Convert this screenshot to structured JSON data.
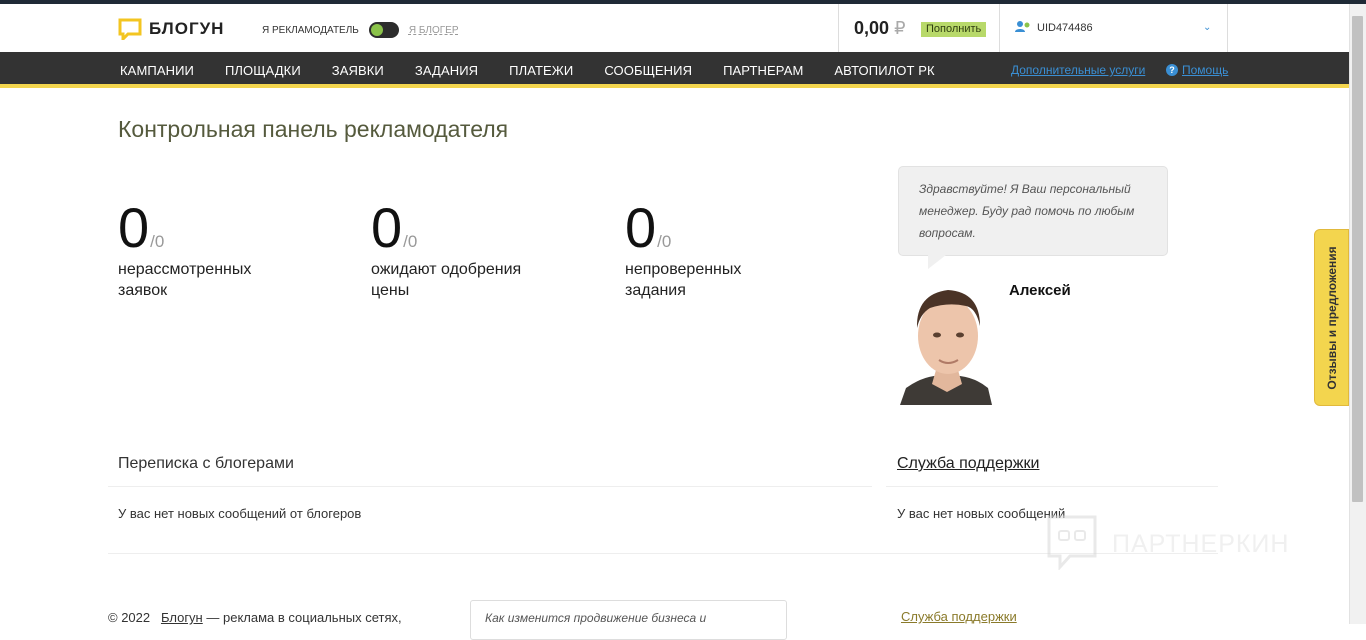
{
  "header": {
    "logo_text": "БЛОГУН",
    "role_active": "Я РЕКЛАМОДАТЕЛЬ",
    "role_inactive": "Я БЛОГЕР",
    "balance": "0,00",
    "currency": "₽",
    "topup_label": "Пополнить",
    "user_id": "UID474486"
  },
  "nav": {
    "items": [
      "КАМПАНИИ",
      "ПЛОЩАДКИ",
      "ЗАЯВКИ",
      "ЗАДАНИЯ",
      "ПЛАТЕЖИ",
      "СООБЩЕНИЯ",
      "ПАРТНЕРАМ",
      "АВТОПИЛОТ РК"
    ],
    "extra_services": "Дополнительные услуги",
    "help": "Помощь"
  },
  "page": {
    "title": "Контрольная панель рекламодателя"
  },
  "stats": [
    {
      "value": "0",
      "total": "/0",
      "label": "нерассмотренных заявок"
    },
    {
      "value": "0",
      "total": "/0",
      "label": "ожидают одобрения цены"
    },
    {
      "value": "0",
      "total": "/0",
      "label": "непроверенных задания"
    }
  ],
  "manager": {
    "greeting": "Здравствуйте! Я Ваш персональный менеджер. Буду рад помочь по любым вопросам.",
    "name": "Алексей"
  },
  "feedback_tab": "Отзывы и предложения",
  "bloggers_section": {
    "title": "Переписка с блогерами",
    "empty": "У вас нет новых сообщений от блогеров"
  },
  "support_section": {
    "title": "Служба поддержки",
    "empty": "У вас нет новых сообщений"
  },
  "watermark": "ПАРТНЕРКИН",
  "footer": {
    "copyright": "© 2022",
    "brand": "Блогун",
    "tagline": "— реклама в социальных сетях,",
    "news": "Как изменится продвижение бизнеса и",
    "support": "Служба поддержки"
  },
  "colors": {
    "nav_bg": "#333333",
    "accent_yellow": "#f3d54e",
    "link_blue": "#3a8fd4",
    "topup_green": "#b8d96a"
  }
}
